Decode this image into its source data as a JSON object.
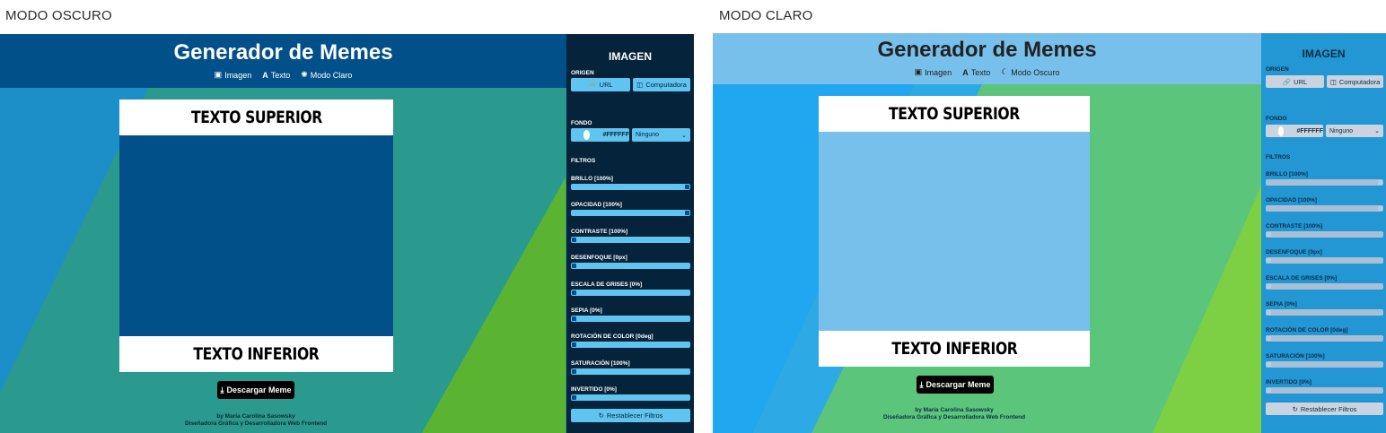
{
  "captions": {
    "dark": "MODO OSCURO",
    "light": "MODO CLARO"
  },
  "app": {
    "title": "Generador de Memes",
    "nav": {
      "image": "Imagen",
      "text": "Texto",
      "dark_mode_toggle": "Modo Claro",
      "light_mode_toggle": "Modo Oscuro"
    },
    "meme": {
      "top_text": "TEXTO SUPERIOR",
      "bottom_text": "TEXTO INFERIOR"
    },
    "download_label": "Descargar Meme",
    "credit_line1": "by Maria Carolina Sasowsky",
    "credit_line2": "Diseñadora Gráfica y Desarrolladora Web Frontend"
  },
  "panel": {
    "title": "IMAGEN",
    "origin_label": "ORIGEN",
    "url_button": "URL",
    "computer_button": "Computadora",
    "background_label": "FONDO",
    "color_value": "#FFFFFF",
    "blend_select": "Ninguno",
    "filters_label": "FILTROS",
    "filters": [
      {
        "label": "BRILLO [100%]",
        "value": 1.0
      },
      {
        "label": "OPACIDAD [100%]",
        "value": 1.0
      },
      {
        "label": "CONTRASTE [100%]",
        "value": 0.0
      },
      {
        "label": "DESENFOQUE [0px]",
        "value": 0.0
      },
      {
        "label": "ESCALA DE GRISES [0%]",
        "value": 0.0
      },
      {
        "label": "SEPIA [0%]",
        "value": 0.0
      },
      {
        "label": "ROTACIÓN DE COLOR [0deg]",
        "value": 0.0
      },
      {
        "label": "SATURACIÓN [100%]",
        "value": 0.0
      },
      {
        "label": "INVERTIDO [0%]",
        "value": 0.0
      }
    ],
    "reset_button": "Restablecer Filtros"
  },
  "colors": {
    "dark_header": "#02508a",
    "dark_panel": "#05233a",
    "dark_meme_bg": "#02508a",
    "light_header": "#78c0ec",
    "light_panel": "#2397d4",
    "light_meme_bg": "#78c0ec",
    "slider_track": "#5fc5f0",
    "accent_green": "#5bb332"
  }
}
